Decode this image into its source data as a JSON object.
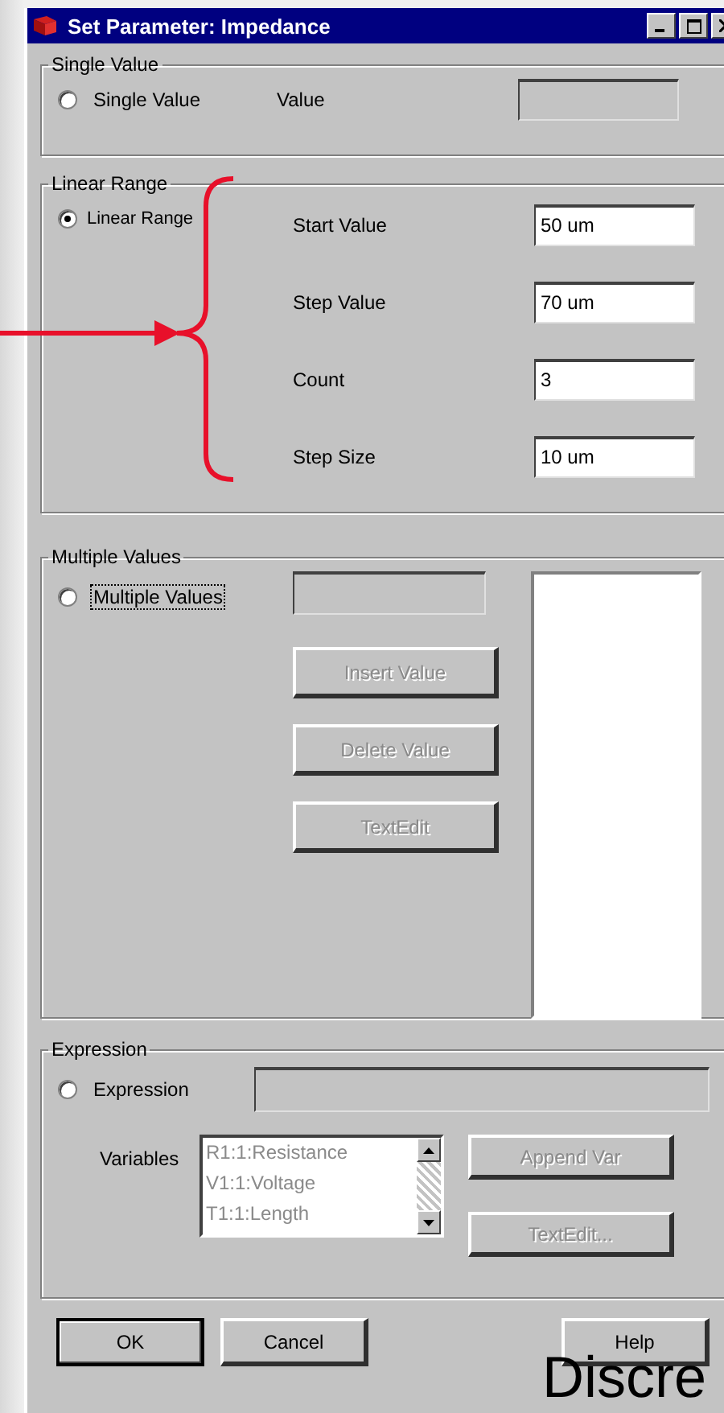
{
  "window": {
    "title": "Set Parameter: Impedance"
  },
  "single": {
    "title": "Single Value",
    "option": {
      "label": "Single Value",
      "selected": false,
      "focused": false
    },
    "value_label": "Value"
  },
  "linear": {
    "title": "Linear Range",
    "option": {
      "label": "Linear Range",
      "selected": true,
      "focused": false
    },
    "fields": [
      {
        "label": "Start Value",
        "value": "50 um"
      },
      {
        "label": "Step Value",
        "value": "70 um"
      },
      {
        "label": "Count",
        "value": "3"
      },
      {
        "label": "Step Size",
        "value": "10 um"
      }
    ]
  },
  "multiple": {
    "title": "Multiple Values",
    "option": {
      "label": "Multiple Values",
      "selected": false,
      "focused": true
    },
    "buttons": [
      {
        "label": "Insert Value",
        "disabled": true
      },
      {
        "label": "Delete Value",
        "disabled": true
      },
      {
        "label": "TextEdit",
        "disabled": true
      }
    ]
  },
  "expression": {
    "title": "Expression",
    "option": {
      "label": "Expression",
      "selected": false,
      "focused": false
    },
    "variables_label": "Variables",
    "variables": [
      "R1:1:Resistance",
      "V1:1:Voltage",
      "T1:1:Length"
    ],
    "buttons": [
      {
        "label": "Append Var",
        "disabled": true
      },
      {
        "label": "TextEdit...",
        "disabled": true
      }
    ]
  },
  "footer": [
    {
      "label": "OK",
      "default": true
    },
    {
      "label": "Cancel",
      "default": false
    },
    {
      "label": "Help",
      "default": false
    }
  ],
  "overlay_text": "Discre"
}
